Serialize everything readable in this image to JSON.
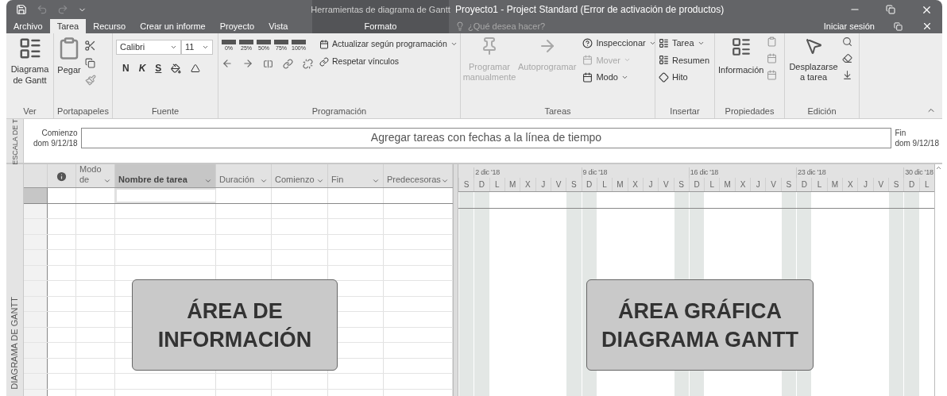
{
  "title_bar": {
    "context_title": "Herramientas de diagrama de Gantt",
    "title": "Proyecto1 - Project Standard (Error de activación de productos)"
  },
  "tabs": [
    {
      "label": "Archivo",
      "selected": false,
      "kind": "file"
    },
    {
      "label": "Tarea",
      "selected": true,
      "kind": "normal"
    },
    {
      "label": "Recurso",
      "selected": false,
      "kind": "normal"
    },
    {
      "label": "Crear un informe",
      "selected": false,
      "kind": "normal"
    },
    {
      "label": "Proyecto",
      "selected": false,
      "kind": "normal"
    },
    {
      "label": "Vista",
      "selected": false,
      "kind": "normal"
    },
    {
      "label": "Formato",
      "selected": false,
      "kind": "context"
    }
  ],
  "search": {
    "placeholder": "¿Qué desea hacer?"
  },
  "sign_in": "Iniciar sesión",
  "ribbon": {
    "ver": {
      "label": "Ver",
      "button": "Diagrama de Gantt"
    },
    "portapapeles": {
      "label": "Portapapeles",
      "paste": "Pegar"
    },
    "fuente": {
      "label": "Fuente",
      "font": "Calibri",
      "size": "11",
      "bold": "N",
      "italic": "K",
      "underline": "S"
    },
    "programacion": {
      "label": "Programación",
      "percents": [
        "0%",
        "25%",
        "50%",
        "75%",
        "100%"
      ],
      "update": "Actualizar según programación",
      "respect": "Respetar vínculos"
    },
    "tareas": {
      "label": "Tareas",
      "manual": {
        "label": "Programar manualmente",
        "disabled": true
      },
      "auto": {
        "label": "Autoprogramar",
        "disabled": true
      },
      "inspect": {
        "label": "Inspeccionar",
        "disabled": false
      },
      "move": {
        "label": "Mover",
        "disabled": true
      },
      "mode": {
        "label": "Modo",
        "disabled": false
      }
    },
    "insertar": {
      "label": "Insertar",
      "task": "Tarea",
      "summary": "Resumen",
      "milestone": "Hito"
    },
    "propiedades": {
      "label": "Propiedades",
      "info": "Información"
    },
    "edicion": {
      "label": "Edición",
      "scroll": "Desplazarse a tarea"
    }
  },
  "timeline": {
    "side_label": "ESCALA DE T",
    "start_label": "Comienzo",
    "start_date": "dom 9/12/18",
    "bar_text": "Agregar tareas con fechas a la línea de tiempo",
    "end_label": "Fin",
    "end_date": "dom 9/12/18"
  },
  "view_label": "DIAGRAMA DE GANTT",
  "table": {
    "columns": [
      {
        "kind": "icon",
        "selected": false
      },
      {
        "kind": "text",
        "label": "Modo de",
        "selected": false
      },
      {
        "kind": "text",
        "label": "Nombre de tarea",
        "selected": true
      },
      {
        "kind": "text",
        "label": "Duración",
        "selected": false
      },
      {
        "kind": "text",
        "label": "Comienzo",
        "selected": false
      },
      {
        "kind": "text",
        "label": "Fin",
        "selected": false
      },
      {
        "kind": "text",
        "label": "Predecesoras",
        "selected": false
      }
    ]
  },
  "gantt": {
    "weeks": [
      "2 dic '18",
      "9 dic '18",
      "16 dic '18",
      "23 dic '18",
      "30 dic '18"
    ],
    "days": [
      {
        "label": "S",
        "weekend": true
      },
      {
        "label": "D",
        "weekend": true
      },
      {
        "label": "L",
        "weekend": false
      },
      {
        "label": "M",
        "weekend": false
      },
      {
        "label": "X",
        "weekend": false
      },
      {
        "label": "J",
        "weekend": false
      },
      {
        "label": "V",
        "weekend": false
      },
      {
        "label": "S",
        "weekend": true
      },
      {
        "label": "D",
        "weekend": true
      },
      {
        "label": "L",
        "weekend": false
      },
      {
        "label": "M",
        "weekend": false
      },
      {
        "label": "X",
        "weekend": false
      },
      {
        "label": "J",
        "weekend": false
      },
      {
        "label": "V",
        "weekend": false
      },
      {
        "label": "S",
        "weekend": true
      },
      {
        "label": "D",
        "weekend": true
      },
      {
        "label": "L",
        "weekend": false
      },
      {
        "label": "M",
        "weekend": false
      },
      {
        "label": "X",
        "weekend": false
      },
      {
        "label": "J",
        "weekend": false
      },
      {
        "label": "V",
        "weekend": false
      },
      {
        "label": "S",
        "weekend": true
      },
      {
        "label": "D",
        "weekend": true
      },
      {
        "label": "L",
        "weekend": false
      },
      {
        "label": "M",
        "weekend": false
      },
      {
        "label": "X",
        "weekend": false
      },
      {
        "label": "J",
        "weekend": false
      },
      {
        "label": "V",
        "weekend": false
      },
      {
        "label": "S",
        "weekend": true
      },
      {
        "label": "D",
        "weekend": true
      },
      {
        "label": "L",
        "weekend": false
      }
    ]
  },
  "callouts": [
    {
      "lines": [
        "ÁREA DE",
        "INFORMACIÓN"
      ]
    },
    {
      "lines": [
        "ÁREA GRÁFICA",
        "DIAGRAMA GANTT"
      ]
    }
  ]
}
